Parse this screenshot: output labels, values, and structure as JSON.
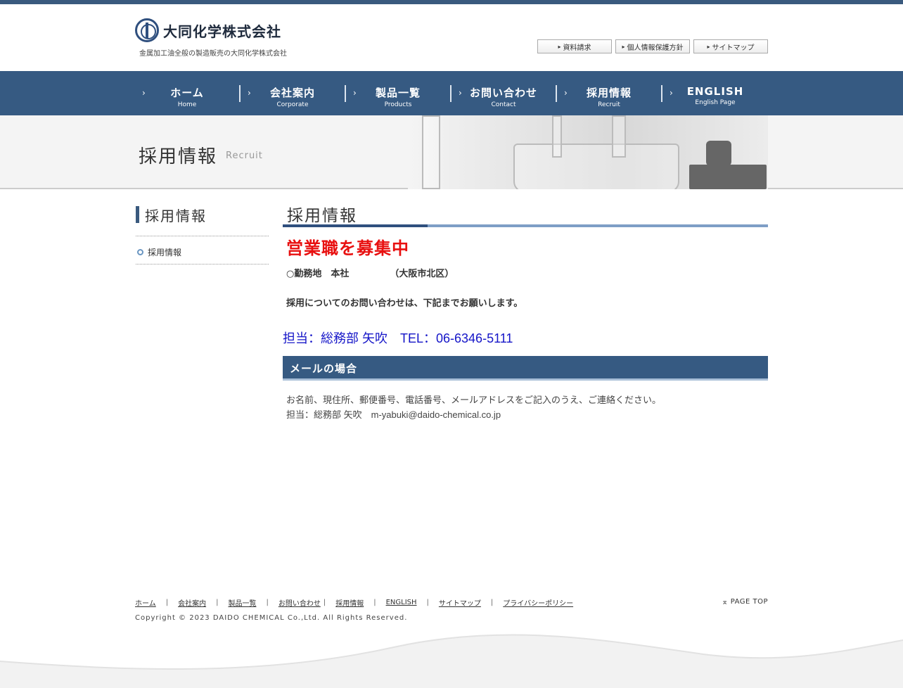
{
  "header": {
    "company_name": "大同化学株式会社",
    "tagline": "金属加工油全般の製造販売の大同化学株式会社",
    "utility_links": [
      "資料請求",
      "個人情報保護方針",
      "サイトマップ"
    ]
  },
  "nav": {
    "items": [
      {
        "jp": "ホーム",
        "en": "Home"
      },
      {
        "jp": "会社案内",
        "en": "Corporate"
      },
      {
        "jp": "製品一覧",
        "en": "Products"
      },
      {
        "jp": "お問い合わせ",
        "en": "Contact"
      },
      {
        "jp": "採用情報",
        "en": "Recruit"
      },
      {
        "jp": "ENGLISH",
        "en": "English Page"
      }
    ]
  },
  "hero": {
    "title": "採用情報",
    "subtitle": "Recruit"
  },
  "sidebar": {
    "title": "採用情報",
    "items": [
      {
        "label": "採用情報"
      }
    ]
  },
  "main": {
    "title": "採用情報",
    "recruit_heading": "営業職を募集中",
    "location_label": "○勤務地　本社",
    "location_note": "（大阪市北区）",
    "inquiry_text": "採用についてのお問い合わせは、下記までお願いします。",
    "contact_line": "担当：総務部 矢吹　TEL：06-6346-5111",
    "mail_section_title": "メールの場合",
    "mail_instructions": "お名前、現住所、郵便番号、電話番号、メールアドレスをご記入のうえ、ご連絡ください。",
    "mail_contact": "担当：総務部 矢吹　m-yabuki@daido-chemical.co.jp"
  },
  "footer": {
    "links": [
      "ホーム",
      "会社案内",
      "製品一覧",
      "お問い合わせ",
      "採用情報",
      "ENGLISH",
      "サイトマップ",
      "プライバシーポリシー"
    ],
    "page_top": "PAGE TOP",
    "copyright": "Copyright © 2023 DAIDO CHEMICAL Co.,Ltd. All Rights Reserved."
  },
  "colors": {
    "nav_blue": "#365a82",
    "accent_red": "#e81010",
    "contact_blue": "#1515c8"
  }
}
